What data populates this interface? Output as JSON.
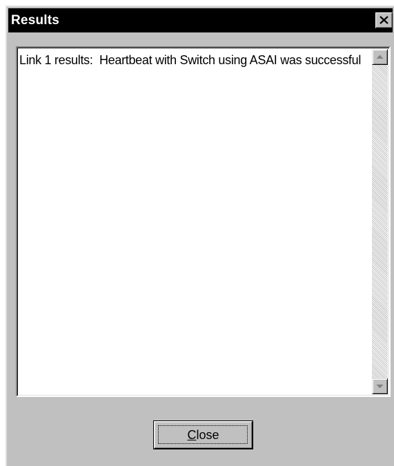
{
  "window": {
    "title": "Results"
  },
  "icons": {
    "close": "close-icon",
    "scroll_up": "arrow-up-icon",
    "scroll_down": "arrow-down-icon"
  },
  "results": {
    "text": "Link 1 results:  Heartbeat with Switch using ASAI was successful"
  },
  "buttons": {
    "close_mnemonic": "C",
    "close_rest": "lose"
  },
  "colors": {
    "titlebar_bg": "#000000",
    "titlebar_text": "#ffffff",
    "dialog_face": "#c0c0c0"
  }
}
